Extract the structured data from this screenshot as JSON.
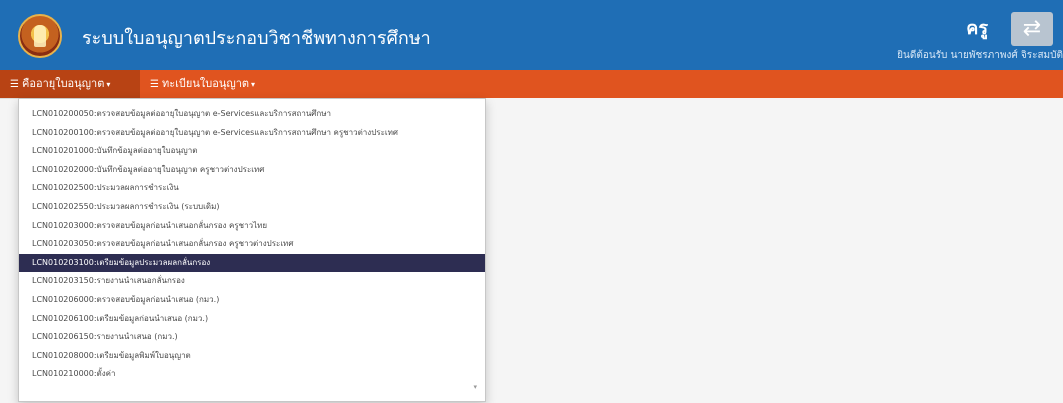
{
  "header": {
    "title": "ระบบใบอนุญาตประกอบวิชาชีพทางการศึกษา",
    "user_role": "ครู",
    "user_name": "ยินดีต้อนรับ นายพัชรภาพงศ์ จิระสมบัติ"
  },
  "navbar": {
    "items": [
      {
        "label": "คืออายุใบอนุญาต",
        "icon": "list-icon"
      },
      {
        "label": "ทะเบียนใบอนุญาต",
        "icon": "list-icon"
      }
    ]
  },
  "dropdown": {
    "items": [
      "LCN010200050:ตรวจสอบข้อมูลต่ออายุใบอนุญาต e-Servicesและบริการสถานศึกษา",
      "LCN010200100:ตรวจสอบข้อมูลต่ออายุใบอนุญาต e-Servicesและบริการสถานศึกษา ครูชาวต่างประเทศ",
      "LCN010201000:บันทึกข้อมูลต่ออายุใบอนุญาต",
      "LCN010202000:บันทึกข้อมูลต่ออายุใบอนุญาต ครูชาวต่างประเทศ",
      "LCN010202500:ประมวลผลการชำระเงิน",
      "LCN010202550:ประมวลผลการชำระเงิน (ระบบเดิม)",
      "LCN010203000:ตรวจสอบข้อมูลก่อนนำเสนอกลั่นกรอง ครูชาวไทย",
      "LCN010203050:ตรวจสอบข้อมูลก่อนนำเสนอกลั่นกรอง ครูชาวต่างประเทศ",
      "LCN010203100:เตรียมข้อมูลประมวลผลกลั่นกรอง",
      "LCN010203150:รายงานนำเสนอกลั่นกรอง",
      "LCN010206000:ตรวจสอบข้อมูลก่อนนำเสนอ (กมว.)",
      "LCN010206100:เตรียมข้อมูลก่อนนำเสนอ (กมว.)",
      "LCN010206150:รายงานนำเสนอ (กมว.)",
      "LCN010208000:เตรียมข้อมูลพิมพ์ใบอนุญาต",
      "LCN010210000:ตั้งค่า"
    ],
    "selected_index": 8
  },
  "colors": {
    "header": "#1f6eb5",
    "navbar": "#e0541f",
    "selected": "#2d2d52"
  }
}
